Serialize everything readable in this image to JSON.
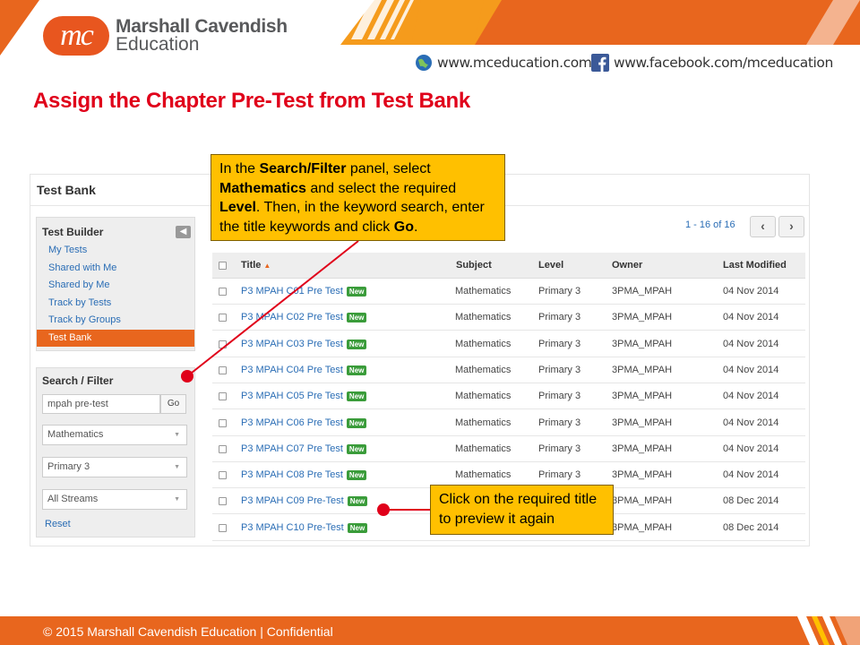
{
  "brand": {
    "logo_mark": "mc",
    "name_line1": "Marshall Cavendish",
    "name_line2": "Education",
    "website": "www.mceducation.com",
    "facebook": "www.facebook.com/mceducation",
    "accent_color": "#e8661e",
    "title_color": "#e0001a"
  },
  "slide_title": "Assign the Chapter Pre-Test from Test Bank",
  "app": {
    "title": "Test Bank",
    "test_builder": {
      "heading": "Test Builder",
      "collapse_icon": "chevron-left-icon",
      "items": [
        {
          "label": "My Tests",
          "active": false
        },
        {
          "label": "Shared with Me",
          "active": false
        },
        {
          "label": "Shared by Me",
          "active": false
        },
        {
          "label": "Track by Tests",
          "active": false
        },
        {
          "label": "Track by Groups",
          "active": false
        },
        {
          "label": "Test Bank",
          "active": true
        }
      ]
    },
    "search_filter": {
      "heading": "Search / Filter",
      "keyword_value": "mpah pre-test",
      "go_label": "Go",
      "subject_value": "Mathematics",
      "level_value": "Primary 3",
      "stream_value": "All Streams",
      "reset_label": "Reset"
    },
    "pagination": {
      "summary": "1 - 16 of 16",
      "prev_icon": "chevron-left-icon",
      "next_icon": "chevron-right-icon"
    },
    "table": {
      "columns": [
        "Title",
        "Subject",
        "Level",
        "Owner",
        "Last Modified"
      ],
      "sort_indicator": "▲",
      "new_badge": "New",
      "rows": [
        {
          "title": "P3 MPAH C01 Pre Test",
          "subject": "Mathematics",
          "level": "Primary 3",
          "owner": "3PMA_MPAH",
          "modified": "04 Nov 2014"
        },
        {
          "title": "P3 MPAH C02 Pre Test",
          "subject": "Mathematics",
          "level": "Primary 3",
          "owner": "3PMA_MPAH",
          "modified": "04 Nov 2014"
        },
        {
          "title": "P3 MPAH C03 Pre Test",
          "subject": "Mathematics",
          "level": "Primary 3",
          "owner": "3PMA_MPAH",
          "modified": "04 Nov 2014"
        },
        {
          "title": "P3 MPAH C04 Pre Test",
          "subject": "Mathematics",
          "level": "Primary 3",
          "owner": "3PMA_MPAH",
          "modified": "04 Nov 2014"
        },
        {
          "title": "P3 MPAH C05 Pre Test",
          "subject": "Mathematics",
          "level": "Primary 3",
          "owner": "3PMA_MPAH",
          "modified": "04 Nov 2014"
        },
        {
          "title": "P3 MPAH C06 Pre Test",
          "subject": "Mathematics",
          "level": "Primary 3",
          "owner": "3PMA_MPAH",
          "modified": "04 Nov 2014"
        },
        {
          "title": "P3 MPAH C07 Pre Test",
          "subject": "Mathematics",
          "level": "Primary 3",
          "owner": "3PMA_MPAH",
          "modified": "04 Nov 2014"
        },
        {
          "title": "P3 MPAH C08 Pre Test",
          "subject": "Mathematics",
          "level": "Primary 3",
          "owner": "3PMA_MPAH",
          "modified": "04 Nov 2014"
        },
        {
          "title": "P3 MPAH C09 Pre-Test",
          "subject": "",
          "level": "",
          "owner": "3PMA_MPAH",
          "modified": "08 Dec 2014"
        },
        {
          "title": "P3 MPAH C10 Pre-Test",
          "subject": "",
          "level": "",
          "owner": "3PMA_MPAH",
          "modified": "08 Dec 2014"
        }
      ]
    }
  },
  "callouts": {
    "filter": {
      "t1": "In the ",
      "b1": "Search/Filter",
      "t2": " panel, select ",
      "b2": "Mathematics",
      "t3": " and select the required ",
      "b3": "Level",
      "t4": ". Then, in the keyword search, enter the title keywords and click ",
      "b4": "Go",
      "t5": "."
    },
    "preview": "Click on the required title to preview it again"
  },
  "footer": "© 2015 Marshall Cavendish Education | Confidential"
}
